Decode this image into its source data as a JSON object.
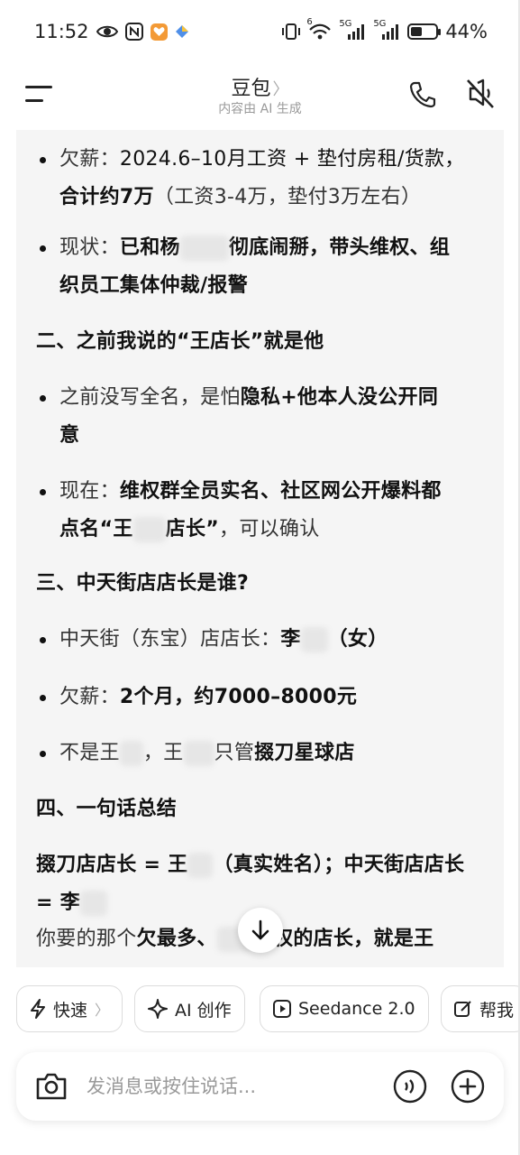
{
  "status_bar": {
    "time": "11:52",
    "icons_left": [
      "eye-icon",
      "nfc-icon",
      "app-notification-icon",
      "app-notification-icon-2"
    ],
    "signal_label_1": "5G",
    "signal_label_2": "5G",
    "wifi_label": "6",
    "battery_level": 0.44,
    "battery_text": "44%"
  },
  "header": {
    "title": "豆包",
    "chevron": "〉",
    "subtitle": "内容由 AI 生成"
  },
  "message": {
    "b1_label": "欠薪：",
    "b1_text": "2024.6–10月工资 + 垫付房租/货款，",
    "b1_text2": "合计约7万",
    "b1_text3": "（工资3-4万，垫付3万左右）",
    "b2_label": "现状：",
    "b2_text1": "已和杨",
    "b2_text2": "彻底闹掰，带头维权、组",
    "b2_text3": "织员工集体仲裁/报警",
    "h2": "二、之前我说的“王店长”就是他",
    "b3_text1": "之前没写全名，是怕",
    "b3_text2": "隐私+他本人没公开同",
    "b3_text3": "意",
    "b4_label": "现在：",
    "b4_text1": "维权群全员实名、社区网公开爆料都",
    "b4_text2": "点名“王",
    "b4_text3": "店长”",
    "b4_text4": "，可以确认",
    "h3": "三、中天街店店长是谁?",
    "b5_text1": "中天街（东宝）店店长：",
    "b5_text2": "李",
    "b5_text3": "（女）",
    "b6_label": "欠薪：",
    "b6_text": "2个月，约7000–8000元",
    "b7_text1": "不是王",
    "b7_text2": "，王",
    "b7_text3": "只管",
    "b7_text4": "掇刀星球店",
    "h4": "四、一句话总结",
    "s1_text1": "掇刀店店长 = 王",
    "s1_text2": "（真实姓名）；中天街店店长",
    "s1_text3": "= 李",
    "s2_text1": "你要的那个",
    "s2_text2": "欠最多、",
    "s2_text3": "维权的店长，就是王"
  },
  "chips": [
    {
      "label": "快速",
      "icon": "lightning-icon",
      "chevron": "〉"
    },
    {
      "label": "AI 创作",
      "icon": "sparkle-icon"
    },
    {
      "label": "Seedance 2.0",
      "icon": "play-icon"
    },
    {
      "label": "帮我",
      "icon": "edit-icon"
    }
  ],
  "input": {
    "placeholder": "发消息或按住说话..."
  }
}
